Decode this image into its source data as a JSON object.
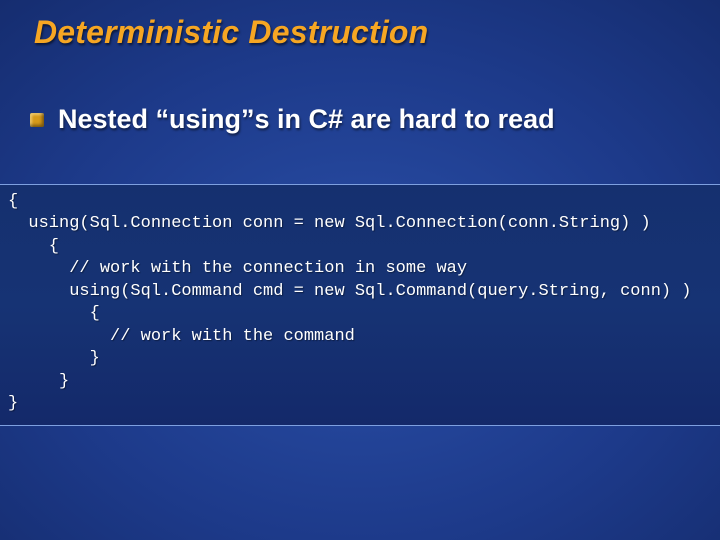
{
  "slide": {
    "title": "Deterministic Destruction",
    "bullet": "Nested “using”s in C# are hard to read",
    "code": "{\n  using(Sql.Connection conn = new Sql.Connection(conn.String) )\n    {\n      // work with the connection in some way\n      using(Sql.Command cmd = new Sql.Command(query.String, conn) )\n        {\n          // work with the command\n        }\n     }\n}"
  }
}
